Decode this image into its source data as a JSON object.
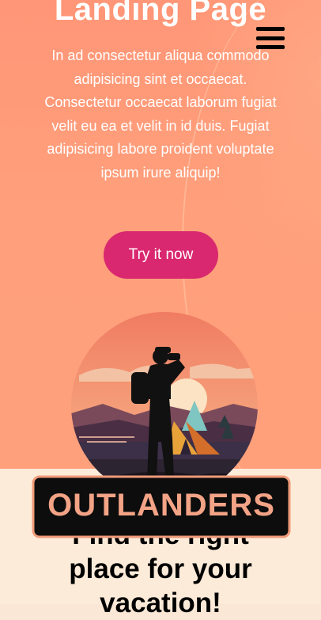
{
  "hero": {
    "title": "Landing Page",
    "description": "In ad consectetur aliqua commodo adipisicing sint et occaecat. Consectetur occaecat laborum fugiat velit eu ea et velit in id duis. Fugiat adipisicing labore proident voluptate ipsum irure aliquip!",
    "cta_label": "Try it now"
  },
  "menu": {
    "icon": "hamburger-menu-icon"
  },
  "logo": {
    "wordmark": "OUTLANDERS"
  },
  "section2": {
    "title_line1": "Find the right",
    "title_line2": "place for your",
    "title_line3": "vacation!"
  },
  "colors": {
    "hero_bg": "#ff9b79",
    "cta_bg": "#d9286f",
    "section_bg": "#fdebd9"
  }
}
